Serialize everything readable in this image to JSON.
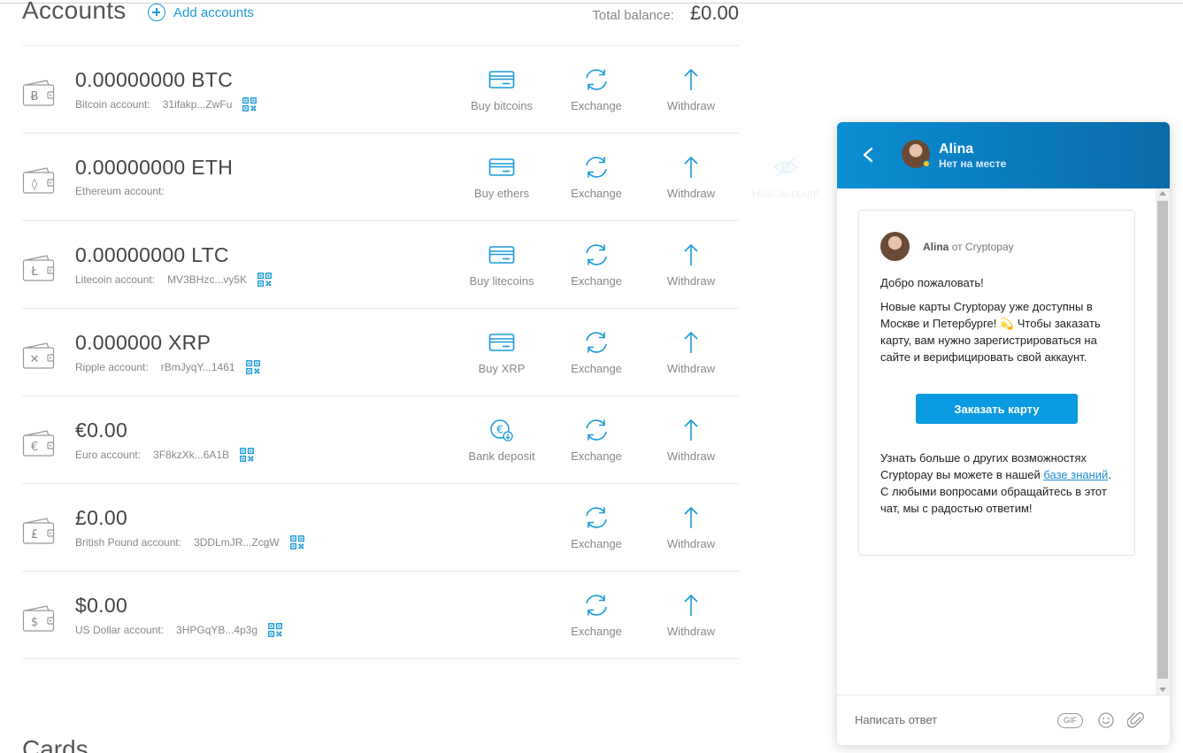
{
  "header": {
    "title": "Accounts",
    "add_accounts": "Add accounts",
    "total_label": "Total balance:",
    "total_value": "£0.00"
  },
  "accounts": [
    {
      "symbol": "Ƀ",
      "amount": "0.00000000 BTC",
      "name": "Bitcoin account:",
      "address": "31ifakp...ZwFu",
      "buy": "Buy bitcoins",
      "exchange": "Exchange",
      "withdraw": "Withdraw"
    },
    {
      "symbol": "◊",
      "amount": "0.00000000 ETH",
      "name": "Ethereum account:",
      "address": "",
      "buy": "Buy ethers",
      "exchange": "Exchange",
      "withdraw": "Withdraw",
      "hide": "Hide account"
    },
    {
      "symbol": "Ł",
      "amount": "0.00000000 LTC",
      "name": "Litecoin account:",
      "address": "MV3BHzc...vy5K",
      "buy": "Buy litecoins",
      "exchange": "Exchange",
      "withdraw": "Withdraw"
    },
    {
      "symbol": "✕",
      "amount": "0.000000 XRP",
      "name": "Ripple account:",
      "address": "rBmJyqY...1461",
      "buy": "Buy XRP",
      "exchange": "Exchange",
      "withdraw": "Withdraw"
    },
    {
      "symbol": "€",
      "amount": "€0.00",
      "name": "Euro account:",
      "address": "3F8kzXk...6A1B",
      "buy": "Bank deposit",
      "exchange": "Exchange",
      "withdraw": "Withdraw"
    },
    {
      "symbol": "£",
      "amount": "£0.00",
      "name": "British Pound account:",
      "address": "3DDLmJR...ZcgW",
      "exchange": "Exchange",
      "withdraw": "Withdraw"
    },
    {
      "symbol": "$",
      "amount": "$0.00",
      "name": "US Dollar account:",
      "address": "3HPGqYB...4p3g",
      "exchange": "Exchange",
      "withdraw": "Withdraw"
    }
  ],
  "cards": {
    "title": "Cards"
  },
  "chat": {
    "agent_name": "Alina",
    "agent_status": "Нет на месте",
    "from_name": "Alina",
    "from_suffix": "от Cryptopay",
    "greeting": "Добро пожаловать!",
    "paragraph1": "Новые карты Cryptopay уже доступны в Москве и Петербурге! 💫 Чтобы заказать карту, вам нужно зарегистрироваться на сайте и верифицировать свой аккаунт.",
    "button": "Заказать карту",
    "paragraph2_before": "Узнать больше о других возможностях Cryptopay вы можете в нашей ",
    "paragraph2_link": "базе знаний",
    "paragraph2_after": ". С любыми вопросами обращайтесь в этот чат, мы с радостью ответим!",
    "reply_placeholder": "Написать ответ",
    "gif_label": "GIF"
  },
  "colors": {
    "accent": "#1a9ad6",
    "chat_header": "#0a7fc2",
    "chat_button": "#0a9ae0"
  }
}
